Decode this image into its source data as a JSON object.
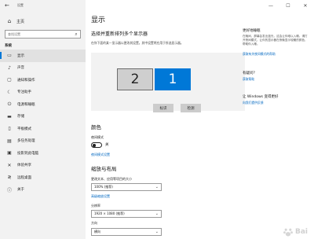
{
  "window": {
    "title": "设置",
    "back_glyph": "←"
  },
  "sidebar": {
    "home_label": "主页",
    "search_placeholder": "查找设置",
    "section_label": "系统",
    "items": [
      {
        "label": "显示",
        "glyph": "▭",
        "active": true
      },
      {
        "label": "声音",
        "glyph": "♪"
      },
      {
        "label": "通知和操作",
        "glyph": "▢"
      },
      {
        "label": "专注助手",
        "glyph": "☾"
      },
      {
        "label": "电源和睡眠",
        "glyph": "⏻"
      },
      {
        "label": "存储",
        "glyph": "▬"
      },
      {
        "label": "平板模式",
        "glyph": "▯"
      },
      {
        "label": "多任务处理",
        "glyph": "▤"
      },
      {
        "label": "投影到此电脑",
        "glyph": "▣"
      },
      {
        "label": "体验共享",
        "glyph": "✕"
      },
      {
        "label": "远程桌面",
        "glyph": "≷"
      },
      {
        "label": "关于",
        "glyph": "ⓘ"
      }
    ]
  },
  "window_controls": {
    "minimize": "—",
    "maximize": "☐",
    "close": "✕"
  },
  "main": {
    "title": "显示",
    "arrange_heading": "选择并重新排列多个显示器",
    "arrange_desc": "在你下面的某一显示器以更改其设置。其中设置将应用于所选显示器。",
    "monitor_2": "2",
    "monitor_1": "1",
    "identify_label": "标识",
    "detect_label": "检测",
    "color_heading": "颜色",
    "night_light_label": "夜间模式",
    "night_light_state": "关",
    "night_light_link": "夜间模式设置",
    "scale_heading": "缩放与布局",
    "scale_label": "更改文本、应用等项目的大小",
    "scale_value": "100% (推荐)",
    "advanced_scale_link": "高级缩放设置",
    "resolution_label": "分辨率",
    "resolution_value": "1920 × 1080 (推荐)",
    "orientation_label": "方向",
    "orientation_value": "横向",
    "chevron": "⌄"
  },
  "right_panel": {
    "sleep_title": "更好地睡眠",
    "sleep_text": "在晚间，屏幕会发出蓝光，这会让你难以入睡。请打开夜间模式，让你的显示器在夜晚显示较暖的颜色，帮助你入睡。",
    "sleep_link": "获取有关夜间模式的帮助",
    "question_title": "有疑问？",
    "help_link": "获取帮助",
    "improve_title": "让 Windows 变得更好",
    "feedback_link": "向我们提供反馈"
  },
  "watermark": {
    "text": "Bai"
  }
}
